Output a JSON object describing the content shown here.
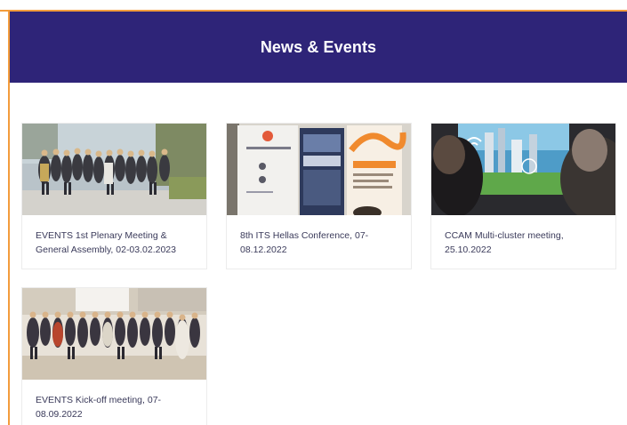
{
  "header": {
    "title": "News & Events"
  },
  "colors": {
    "header_bg": "#2e2478",
    "accent_border": "#f39c3c",
    "caption_text": "#3a3a5a"
  },
  "cards": [
    {
      "caption": "EVENTS 1st Plenary Meeting & General Assembly, 02-03.02.2023",
      "image": "group-photo-outdoor"
    },
    {
      "caption": "8th ITS Hellas Conference, 07-08.12.2022",
      "image": "conference-banners"
    },
    {
      "caption": "CCAM Multi-cluster meeting, 25.10.2022",
      "image": "presentation-screen"
    },
    {
      "caption": "EVENTS Kick-off meeting, 07-08.09.2022",
      "image": "group-photo-indoor"
    }
  ]
}
